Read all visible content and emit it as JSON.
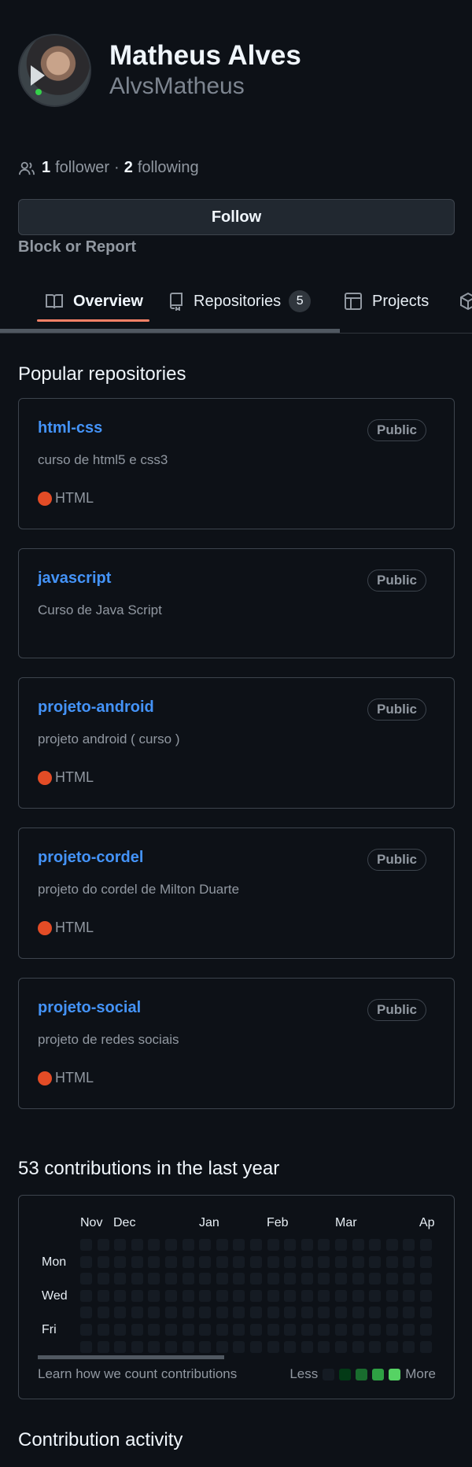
{
  "profile": {
    "full_name": "Matheus Alves",
    "login": "AlvsMatheus",
    "followers_count": "1",
    "followers_label": "follower",
    "separator": "·",
    "following_count": "2",
    "following_label": "following",
    "follow_button": "Follow",
    "block_report": "Block or Report"
  },
  "tabs": [
    {
      "label": "Overview",
      "icon": "book-icon",
      "active": true
    },
    {
      "label": "Repositories",
      "icon": "repo-icon",
      "counter": "5"
    },
    {
      "label": "Projects",
      "icon": "table-icon"
    },
    {
      "label": "",
      "icon": "package-icon"
    }
  ],
  "popular": {
    "title": "Popular repositories",
    "repos": [
      {
        "name": "html-css",
        "visibility": "Public",
        "description": "curso de html5 e css3",
        "language": "HTML",
        "lang_color": "#e34c26"
      },
      {
        "name": "javascript",
        "visibility": "Public",
        "description": "Curso de Java Script",
        "language": "",
        "lang_color": ""
      },
      {
        "name": "projeto-android",
        "visibility": "Public",
        "description": "projeto android ( curso )",
        "language": "HTML",
        "lang_color": "#e34c26"
      },
      {
        "name": "projeto-cordel",
        "visibility": "Public",
        "description": "projeto do cordel de Milton Duarte",
        "language": "HTML",
        "lang_color": "#e34c26"
      },
      {
        "name": "projeto-social",
        "visibility": "Public",
        "description": "projeto de redes sociais",
        "language": "HTML",
        "lang_color": "#e34c26"
      }
    ]
  },
  "contributions": {
    "title": "53 contributions in the last year",
    "months": [
      "Nov",
      "Dec",
      "Jan",
      "Feb",
      "Mar",
      "Ap"
    ],
    "days": [
      "Mon",
      "Wed",
      "Fri"
    ],
    "learn_link": "Learn how we count contributions",
    "legend_less": "Less",
    "legend_more": "More",
    "level_colors": [
      "#151b23",
      "#033a16",
      "#196c2e",
      "#2ea043",
      "#56d364"
    ]
  },
  "activity": {
    "title": "Contribution activity"
  }
}
